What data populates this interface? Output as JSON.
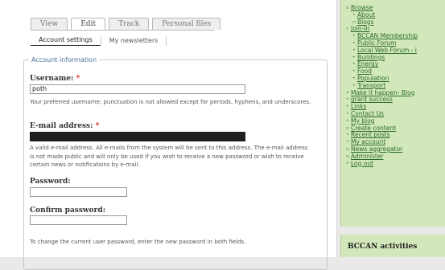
{
  "tabs": [
    "View",
    "Edit",
    "Track",
    "Personal files"
  ],
  "subtabs": [
    "Account settings",
    "My newsletters"
  ],
  "form": {
    "legend": "Account information",
    "required_marker": "*",
    "username_label": "Username:",
    "username_value": "poth",
    "username_help": "Your preferred username; punctuation is not allowed except for periods, hyphens, and underscores.",
    "email_label": "E-mail address:",
    "email_help": "A valid e-mail address. All e-mails from the system will be sent to this address. The e-mail address is not made public and will only be used if you wish to receive a new password or wish to receive certain news or notifications by e-mail.",
    "password_label": "Password:",
    "confirm_label": "Confirm password:",
    "password_help": "To change the current user password, enter the new password in both fields."
  },
  "sidebar": {
    "items": [
      {
        "label": "Browse",
        "bullet": "▫"
      },
      {
        "label": "About",
        "bullet": "•"
      },
      {
        "label": "Blogs",
        "bullet": "▫"
      },
      {
        "label": "Join-In",
        "bullet": "▿"
      },
      {
        "label": "BCCAN Membership",
        "bullet": "•"
      },
      {
        "label": "Public Forum",
        "bullet": "•"
      },
      {
        "label": "Local Web Forum - i",
        "bullet": "•"
      },
      {
        "label": "Buildings",
        "bullet": "•"
      },
      {
        "label": "Energy",
        "bullet": "•"
      },
      {
        "label": "Food",
        "bullet": "•"
      },
      {
        "label": "Population",
        "bullet": "•"
      },
      {
        "label": "Transport",
        "bullet": "•"
      },
      {
        "label": "Make it happen- Blog",
        "bullet": "•"
      },
      {
        "label": "grant success",
        "bullet": "•"
      },
      {
        "label": "Links",
        "bullet": "•"
      },
      {
        "label": "Contact Us",
        "bullet": "•"
      },
      {
        "label": "My blog",
        "bullet": "•"
      },
      {
        "label": "Create content",
        "bullet": "▫"
      },
      {
        "label": "Recent posts",
        "bullet": "•"
      },
      {
        "label": "My account",
        "bullet": "•"
      },
      {
        "label": "News aggregator",
        "bullet": "▫"
      },
      {
        "label": "Administer",
        "bullet": "▫"
      },
      {
        "label": "Log out",
        "bullet": "•"
      }
    ],
    "activities_title": "BCCAN activities"
  }
}
